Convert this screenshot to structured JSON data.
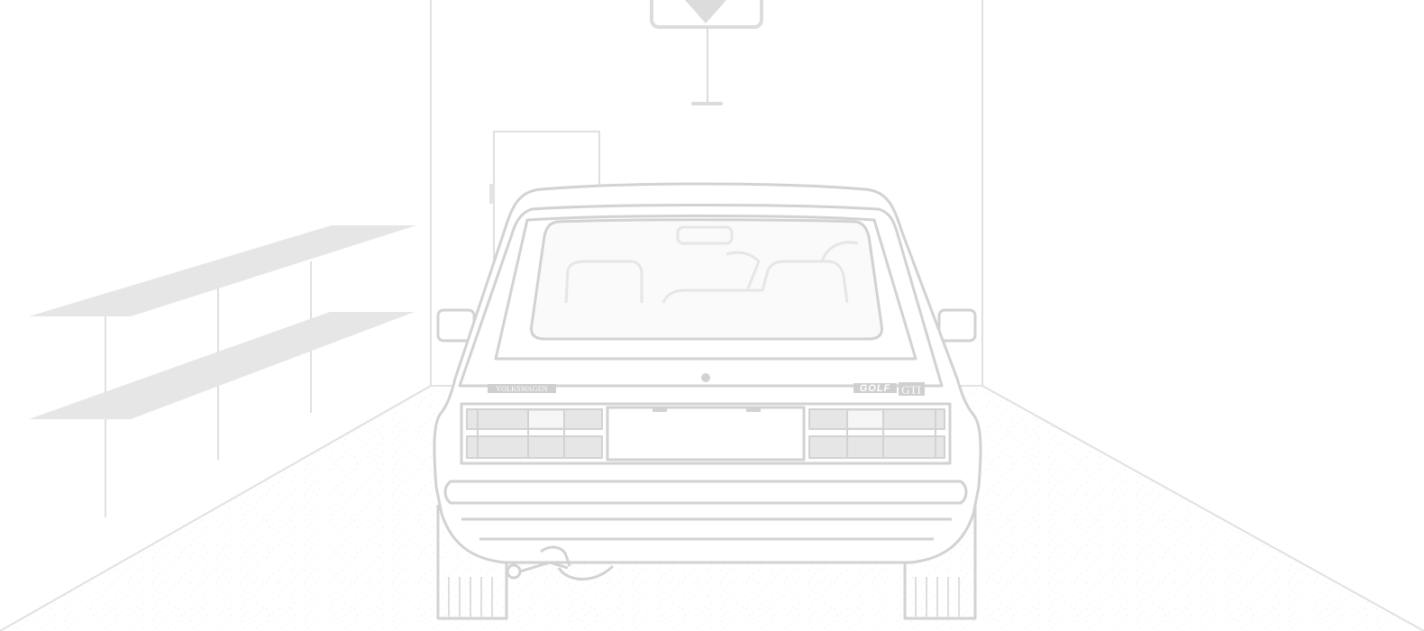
{
  "scene": {
    "badges": {
      "make": "VOLKSWAGEN",
      "model": "GOLF",
      "trim": "GTI"
    },
    "colors": {
      "background": "#ffffff",
      "line": "#dcdcdc",
      "car_line": "#d2d2d2",
      "fill_light": "#e6e6e6",
      "floor_speckle": "#f1f1f1"
    },
    "icons": {
      "sign": "yield-sign-icon",
      "shelf": "wall-shelf-icon",
      "door": "door-icon",
      "car": "hatchback-rear-icon"
    }
  }
}
